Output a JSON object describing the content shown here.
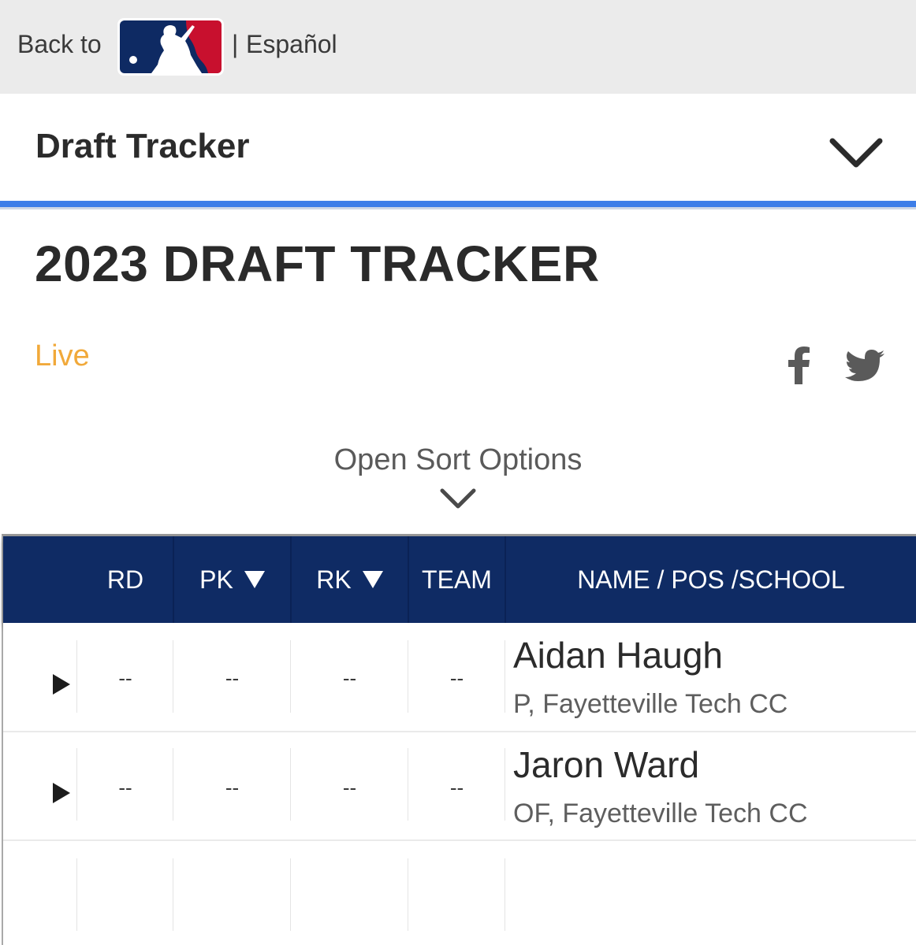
{
  "topbar": {
    "back_label": "Back to",
    "separator": "|",
    "language_link": "Español",
    "logo_icon": "mlb-logo-icon"
  },
  "section": {
    "title": "Draft Tracker"
  },
  "page": {
    "title": "2023 DRAFT TRACKER",
    "status": "Live"
  },
  "share": {
    "icons": [
      "facebook-icon",
      "twitter-icon"
    ]
  },
  "sort": {
    "label": "Open Sort Options"
  },
  "table": {
    "headers": {
      "rd": "RD",
      "pk": "PK",
      "rk": "RK",
      "team": "TEAM",
      "name": "NAME / POS /SCHOOL"
    },
    "rows": [
      {
        "rd": "--",
        "pk": "--",
        "rk": "--",
        "team": "--",
        "name": "Aidan Haugh",
        "pos_school": "P, Fayetteville Tech CC"
      },
      {
        "rd": "--",
        "pk": "--",
        "rk": "--",
        "team": "--",
        "name": "Jaron Ward",
        "pos_school": "OF, Fayetteville Tech CC"
      }
    ]
  },
  "colors": {
    "header_navy": "#0f2b64",
    "accent_blue": "#3d7ee8",
    "live_orange": "#f1a93a",
    "mlb_red": "#c8102e"
  }
}
